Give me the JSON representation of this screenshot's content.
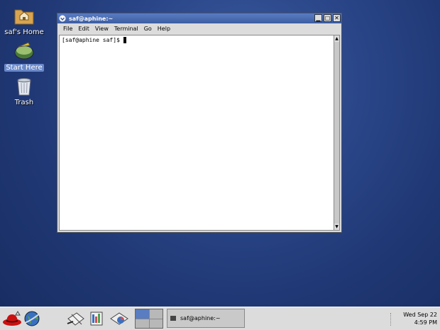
{
  "desktop": {
    "icons": [
      {
        "label": "saf's Home",
        "icon": "home-folder-icon"
      },
      {
        "label": "Start Here",
        "icon": "start-here-icon"
      },
      {
        "label": "Trash",
        "icon": "trash-icon"
      }
    ]
  },
  "window": {
    "title": "saf@aphine:~",
    "menu": [
      "File",
      "Edit",
      "View",
      "Terminal",
      "Go",
      "Help"
    ],
    "prompt": "[saf@aphine saf]$"
  },
  "panel": {
    "task_label": "saf@aphine:~",
    "clock_date": "Wed Sep 22",
    "clock_time": "4:59 PM"
  },
  "colors": {
    "desktop": "#2a4688",
    "titlebar": "#3c5da3",
    "panel": "#dcdcdc"
  }
}
